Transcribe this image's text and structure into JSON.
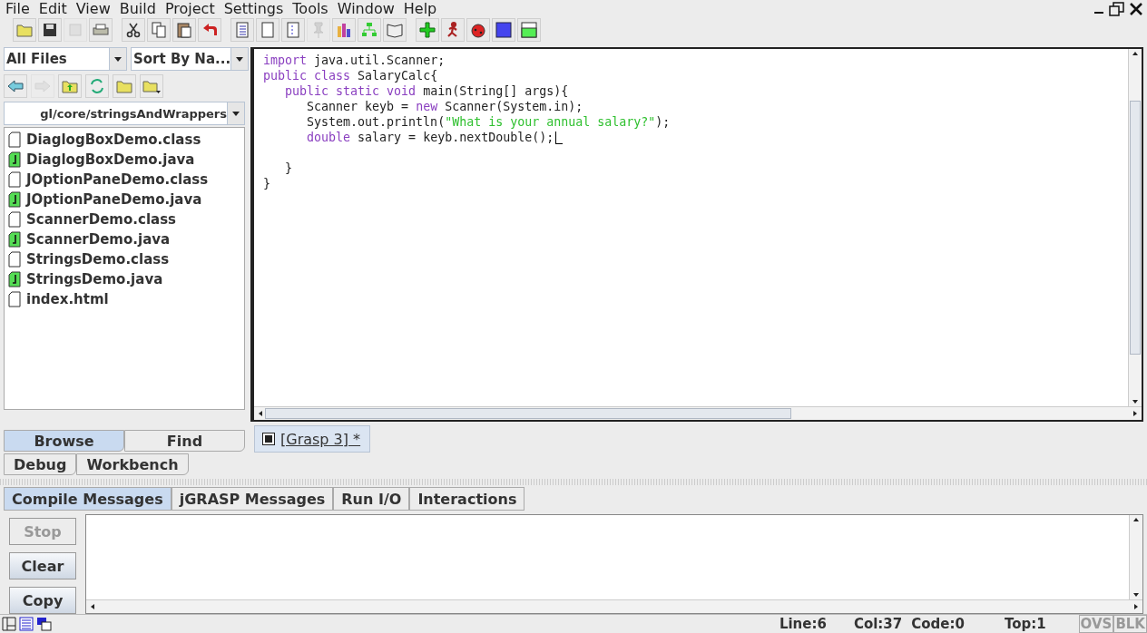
{
  "menu": [
    {
      "label": "File"
    },
    {
      "label": "Edit"
    },
    {
      "label": "View"
    },
    {
      "label": "Build"
    },
    {
      "label": "Project"
    },
    {
      "label": "Settings"
    },
    {
      "label": "Tools"
    },
    {
      "label": "Window"
    },
    {
      "label": "Help"
    }
  ],
  "toolbar": [
    [
      {
        "disabled": false
      },
      {
        "disabled": false
      },
      {
        "disabled": true
      },
      {
        "disabled": false
      }
    ],
    [
      {
        "disabled": false
      },
      {
        "disabled": false
      },
      {
        "disabled": false
      },
      {
        "disabled": false
      }
    ],
    [
      {
        "disabled": false
      },
      {
        "disabled": false
      },
      {
        "disabled": false
      },
      {
        "disabled": true
      },
      {
        "disabled": false
      },
      {
        "disabled": false
      },
      {
        "disabled": false
      }
    ],
    [
      {
        "disabled": false
      },
      {
        "disabled": false
      },
      {
        "disabled": false
      },
      {
        "disabled": false
      },
      {
        "disabled": false
      }
    ]
  ],
  "browser": {
    "filter": "All Files",
    "sort": "Sort By Na...",
    "nav": [
      {
        "disabled": false
      },
      {
        "disabled": true
      },
      {
        "disabled": false
      },
      {
        "disabled": false
      },
      {
        "disabled": false
      },
      {
        "disabled": false
      }
    ],
    "path": "gl/core/stringsAndWrappers",
    "files": [
      {
        "name": "DiaglogBoxDemo.class",
        "kind": "class"
      },
      {
        "name": "DiaglogBoxDemo.java",
        "kind": "java"
      },
      {
        "name": "JOptionPaneDemo.class",
        "kind": "class"
      },
      {
        "name": "JOptionPaneDemo.java",
        "kind": "java"
      },
      {
        "name": "ScannerDemo.class",
        "kind": "class"
      },
      {
        "name": "ScannerDemo.java",
        "kind": "java"
      },
      {
        "name": "StringsDemo.class",
        "kind": "class"
      },
      {
        "name": "StringsDemo.java",
        "kind": "java"
      },
      {
        "name": "index.html",
        "kind": "class"
      }
    ],
    "tabs": [
      [
        {
          "label": "Browse",
          "selected": true
        },
        {
          "label": "Find",
          "selected": false
        }
      ],
      [
        {
          "label": "Debug",
          "selected": false
        },
        {
          "label": "Workbench",
          "selected": false
        }
      ]
    ]
  },
  "editor": {
    "lines": [
      {
        "kind": "code",
        "tokens": [
          {
            "kind": "kw",
            "text": "import"
          },
          {
            "kind": "plain",
            "text": " java.util.Scanner;"
          }
        ]
      },
      {
        "kind": "code",
        "tokens": [
          {
            "kind": "kw",
            "text": "public class"
          },
          {
            "kind": "plain",
            "text": " SalaryCalc{"
          }
        ]
      },
      {
        "kind": "code",
        "tokens": [
          {
            "kind": "kw",
            "text": "   public static void"
          },
          {
            "kind": "plain",
            "text": " main(String[] args){"
          }
        ]
      },
      {
        "kind": "code",
        "tokens": [
          {
            "kind": "plain",
            "text": "      Scanner keyb = "
          },
          {
            "kind": "kw",
            "text": "new"
          },
          {
            "kind": "plain",
            "text": " Scanner(System.in);"
          }
        ]
      },
      {
        "kind": "code",
        "tokens": [
          {
            "kind": "plain",
            "text": "      System.out.println("
          },
          {
            "kind": "str",
            "text": "\"What is your annual salary?\""
          },
          {
            "kind": "plain",
            "text": ");"
          }
        ]
      },
      {
        "kind": "code",
        "caret": true,
        "tokens": [
          {
            "kind": "kw",
            "text": "      double"
          },
          {
            "kind": "plain",
            "text": " salary = keyb.nextDouble();"
          }
        ]
      },
      {
        "kind": "blank"
      },
      {
        "kind": "code",
        "tokens": [
          {
            "kind": "plain",
            "text": "   }"
          }
        ]
      },
      {
        "kind": "code",
        "tokens": [
          {
            "kind": "plain",
            "text": "}"
          }
        ]
      }
    ],
    "doc_tab": {
      "label": "[Grasp 3] *",
      "selected": true
    }
  },
  "messages": {
    "tabs": [
      {
        "label": "Compile Messages",
        "selected": true
      },
      {
        "label": "jGRASP Messages",
        "selected": false
      },
      {
        "label": "Run I/O",
        "selected": false
      },
      {
        "label": "Interactions",
        "selected": false
      }
    ],
    "buttons": [
      {
        "label": "Stop",
        "disabled": true
      },
      {
        "label": "Clear",
        "disabled": false
      },
      {
        "label": "Copy",
        "disabled": false
      }
    ]
  },
  "status_bar": {
    "fields": [
      "Line:6",
      "Col:37",
      "Code:0",
      "Top:1"
    ],
    "modes": [
      {
        "label": "OVS",
        "on": false
      },
      {
        "label": "BLK",
        "on": false
      }
    ]
  }
}
